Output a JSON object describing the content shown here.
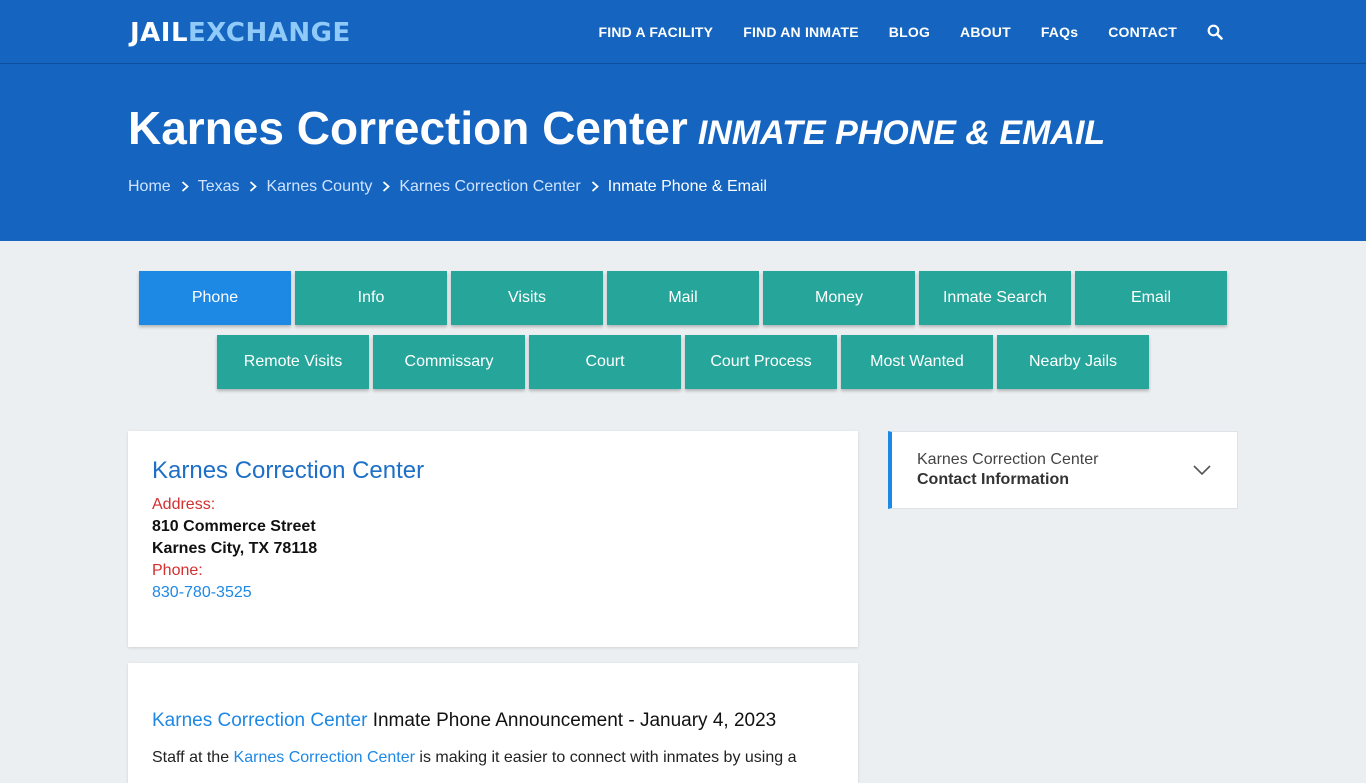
{
  "logo": {
    "part1": "JAIL",
    "part2": "EXCHANGE"
  },
  "nav": {
    "items": [
      "FIND A FACILITY",
      "FIND AN INMATE",
      "BLOG",
      "ABOUT",
      "FAQs",
      "CONTACT"
    ],
    "search_icon": "search-icon"
  },
  "hero": {
    "title": "Karnes Correction Center",
    "subtitle": "INMATE PHONE & EMAIL",
    "breadcrumbs": [
      "Home",
      "Texas",
      "Karnes County",
      "Karnes Correction Center"
    ],
    "current": "Inmate Phone & Email"
  },
  "tabs": {
    "row1": [
      "Phone",
      "Info",
      "Visits",
      "Mail",
      "Money",
      "Inmate Search",
      "Email"
    ],
    "row2": [
      "Remote Visits",
      "Commissary",
      "Court",
      "Court Process",
      "Most Wanted",
      "Nearby Jails"
    ],
    "active": "Phone"
  },
  "facility": {
    "name": "Karnes Correction Center",
    "address_label": "Address:",
    "street": "810 Commerce Street",
    "city": "Karnes City, TX 78118",
    "phone_label": "Phone:",
    "phone": "830-780-3525"
  },
  "announcement": {
    "link": "Karnes Correction Center",
    "title_rest": " Inmate Phone Announcement - January 4, 2023",
    "para_start": "Staff at the ",
    "para_link": "Karnes Correction Center",
    "para_end": " is making it easier to connect with inmates by using a"
  },
  "sidebar": {
    "line1": "Karnes Correction Center",
    "line2": "Contact Information",
    "icon": "chevron-down-icon"
  },
  "colors": {
    "brand": "#1565c0",
    "tab": "#26a69a",
    "tab_active": "#1e88e5",
    "link": "#1e88e5",
    "label": "#d32f2f"
  }
}
